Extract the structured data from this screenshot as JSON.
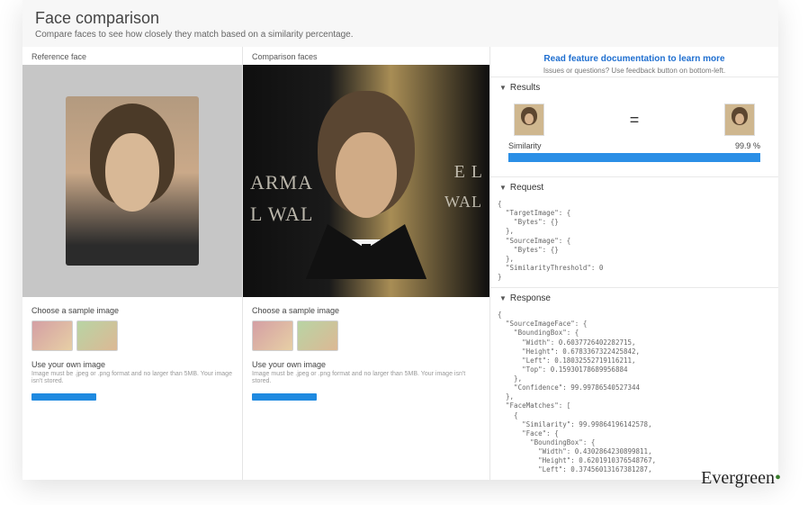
{
  "header": {
    "title": "Face comparison",
    "subtitle": "Compare faces to see how closely they match based on a similarity percentage."
  },
  "reference": {
    "label": "Reference face",
    "choose_label": "Choose a sample image",
    "own_label": "Use your own image",
    "own_hint": "Image must be .jpeg or .png format and no larger than 5MB. Your image isn't stored."
  },
  "comparison": {
    "label": "Comparison faces",
    "bg_text": {
      "t1": "ARMA",
      "t2": "L WAL",
      "t3": "E L",
      "t4": "WAL"
    },
    "choose_label": "Choose a sample image",
    "own_label": "Use your own image",
    "own_hint": "Image must be .jpeg or .png format and no larger than 5MB. Your image isn't stored."
  },
  "info": {
    "doc_link": "Read feature documentation to learn more",
    "doc_sub": "Issues or questions? Use feedback button on bottom-left."
  },
  "results": {
    "section": "Results",
    "eq": "=",
    "similarity_label": "Similarity",
    "similarity_value": "99.9 %",
    "similarity_percent": 99.9
  },
  "request": {
    "section": "Request",
    "code": "{\n  \"TargetImage\": {\n    \"Bytes\": {}\n  },\n  \"SourceImage\": {\n    \"Bytes\": {}\n  },\n  \"SimilarityThreshold\": 0\n}"
  },
  "response": {
    "section": "Response",
    "code": "{\n  \"SourceImageFace\": {\n    \"BoundingBox\": {\n      \"Width\": 0.6037726402282715,\n      \"Height\": 0.6783367322425842,\n      \"Left\": 0.18032552719116211,\n      \"Top\": 0.15930178689956884\n    },\n    \"Confidence\": 99.99786540527344\n  },\n  \"FaceMatches\": [\n    {\n      \"Similarity\": 99.99864196142578,\n      \"Face\": {\n        \"BoundingBox\": {\n          \"Width\": 0.4302864230899811,\n          \"Height\": 0.6201910376548767,\n          \"Left\": 0.37456013167381287,"
  },
  "watermark": "Evergreen"
}
